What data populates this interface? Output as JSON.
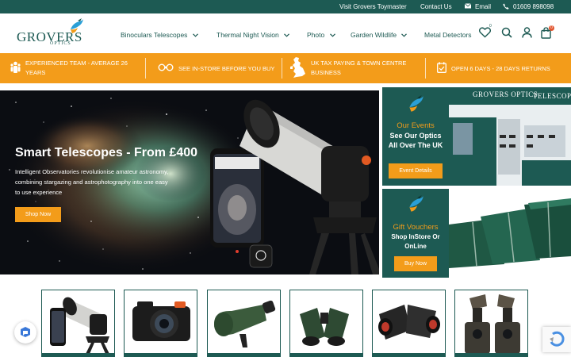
{
  "topbar": {
    "visit_link": "Visit Grovers Toymaster",
    "contact_link": "Contact Us",
    "email_link": "Email",
    "phone": "01609 898098"
  },
  "header": {
    "logo_text": "GROVERS",
    "logo_sub": "OPTICS",
    "nav": [
      {
        "label": "Binoculars Telescopes"
      },
      {
        "label": "Thermal Night Vision"
      },
      {
        "label": "Photo"
      },
      {
        "label": "Garden Wildlife"
      },
      {
        "label": "Metal Detectors"
      }
    ],
    "wishlist_count": "0",
    "cart_count": "0"
  },
  "usp": [
    {
      "text": "EXPERIENCED TEAM - AVERAGE 26 YEARS",
      "icon": "team-icon"
    },
    {
      "text": "SEE IN-STORE BEFORE YOU BUY",
      "icon": "binoculars-icon"
    },
    {
      "text": "UK TAX PAYING & TOWN CENTRE BUSINESS",
      "icon": "uk-map-icon"
    },
    {
      "text": "OPEN 6 DAYS - 28 DAYS RETURNS",
      "icon": "calendar-icon"
    }
  ],
  "hero": {
    "title": "Smart Telescopes - From £400",
    "subtitle": "Intelligent Observatories revolutionise amateur astronomy, combining stargazing and astrophotography into one easy to use experience",
    "button": "Shop Now"
  },
  "promo_events": {
    "title": "Our Events",
    "body": "See Our Optics All Over The UK",
    "button": "Event Details",
    "banner_text": "GROVERS OPTICS",
    "banner_text2": "TELESCOP"
  },
  "promo_vouchers": {
    "title": "Gift Vouchers",
    "body": "Shop InStore Or OnLine",
    "button": "Buy Now"
  },
  "products": [
    {
      "icon": "smart-telescope-icon"
    },
    {
      "icon": "camera-icon"
    },
    {
      "icon": "spotting-scope-icon"
    },
    {
      "icon": "binoculars-icon"
    },
    {
      "icon": "thermal-binoculars-icon"
    },
    {
      "icon": "trail-camera-icon"
    }
  ],
  "colors": {
    "brand_green": "#1d5a53",
    "accent_orange": "#f39c1a",
    "badge_red": "#e2552f"
  }
}
